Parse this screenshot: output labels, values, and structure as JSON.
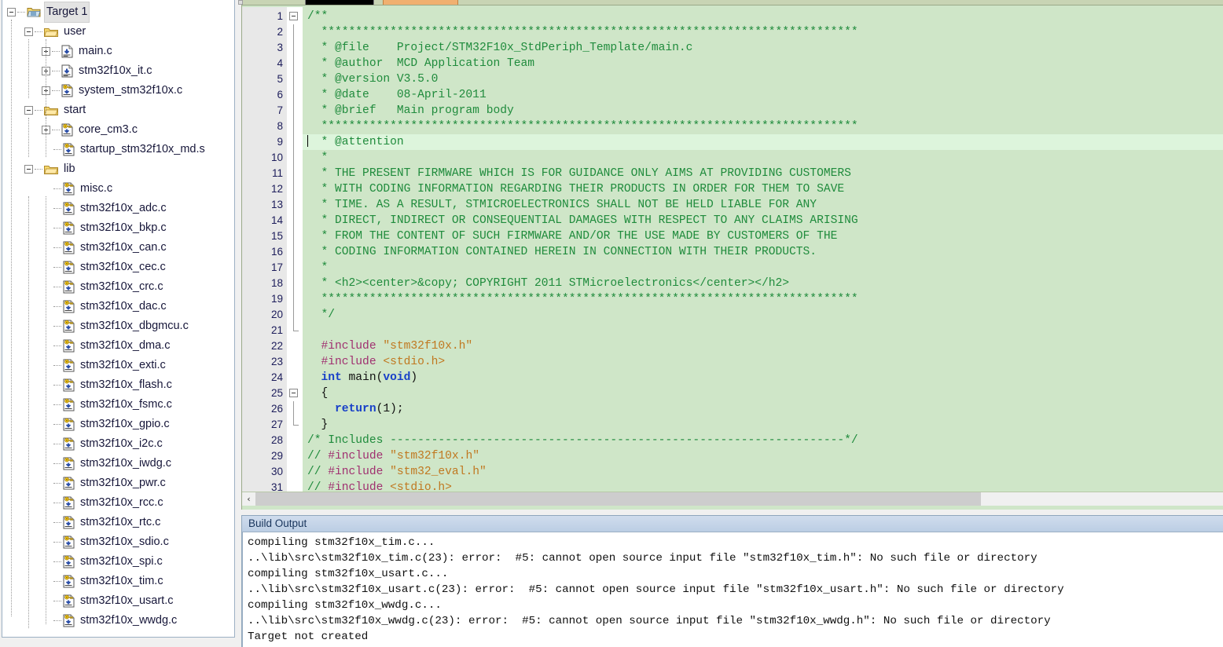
{
  "project": {
    "root": {
      "label": "Target 1",
      "icon": "project-target-icon",
      "selected": true,
      "expander": "minus"
    },
    "groups": [
      {
        "label": "user",
        "icon": "folder-icon",
        "expander": "minus",
        "files": [
          {
            "label": "main.c",
            "icon": "c-source-icon",
            "expander": "plus"
          },
          {
            "label": "stm32f10x_it.c",
            "icon": "c-source-icon",
            "expander": "plus"
          },
          {
            "label": "system_stm32f10x.c",
            "icon": "c-source-compiled-icon",
            "expander": "plus"
          }
        ]
      },
      {
        "label": "start",
        "icon": "folder-icon",
        "expander": "minus",
        "files": [
          {
            "label": "core_cm3.c",
            "icon": "c-source-compiled-icon",
            "expander": "plus"
          },
          {
            "label": "startup_stm32f10x_md.s",
            "icon": "c-source-compiled-icon",
            "expander": "none"
          }
        ]
      },
      {
        "label": "lib",
        "icon": "folder-icon",
        "expander": "minus",
        "files": [
          {
            "label": "misc.c",
            "icon": "c-source-compiled-icon",
            "expander": "none"
          },
          {
            "label": "stm32f10x_adc.c",
            "icon": "c-source-compiled-icon",
            "expander": "none"
          },
          {
            "label": "stm32f10x_bkp.c",
            "icon": "c-source-compiled-icon",
            "expander": "none"
          },
          {
            "label": "stm32f10x_can.c",
            "icon": "c-source-compiled-icon",
            "expander": "none"
          },
          {
            "label": "stm32f10x_cec.c",
            "icon": "c-source-compiled-icon",
            "expander": "none"
          },
          {
            "label": "stm32f10x_crc.c",
            "icon": "c-source-compiled-icon",
            "expander": "none"
          },
          {
            "label": "stm32f10x_dac.c",
            "icon": "c-source-compiled-icon",
            "expander": "none"
          },
          {
            "label": "stm32f10x_dbgmcu.c",
            "icon": "c-source-compiled-icon",
            "expander": "none"
          },
          {
            "label": "stm32f10x_dma.c",
            "icon": "c-source-compiled-icon",
            "expander": "none"
          },
          {
            "label": "stm32f10x_exti.c",
            "icon": "c-source-compiled-icon",
            "expander": "none"
          },
          {
            "label": "stm32f10x_flash.c",
            "icon": "c-source-compiled-icon",
            "expander": "none"
          },
          {
            "label": "stm32f10x_fsmc.c",
            "icon": "c-source-compiled-icon",
            "expander": "none"
          },
          {
            "label": "stm32f10x_gpio.c",
            "icon": "c-source-compiled-icon",
            "expander": "none"
          },
          {
            "label": "stm32f10x_i2c.c",
            "icon": "c-source-compiled-icon",
            "expander": "none"
          },
          {
            "label": "stm32f10x_iwdg.c",
            "icon": "c-source-compiled-icon",
            "expander": "none"
          },
          {
            "label": "stm32f10x_pwr.c",
            "icon": "c-source-compiled-icon",
            "expander": "none"
          },
          {
            "label": "stm32f10x_rcc.c",
            "icon": "c-source-compiled-icon",
            "expander": "none"
          },
          {
            "label": "stm32f10x_rtc.c",
            "icon": "c-source-compiled-icon",
            "expander": "none"
          },
          {
            "label": "stm32f10x_sdio.c",
            "icon": "c-source-compiled-icon",
            "expander": "none"
          },
          {
            "label": "stm32f10x_spi.c",
            "icon": "c-source-compiled-icon",
            "expander": "none"
          },
          {
            "label": "stm32f10x_tim.c",
            "icon": "c-source-compiled-icon",
            "expander": "none"
          },
          {
            "label": "stm32f10x_usart.c",
            "icon": "c-source-compiled-icon",
            "expander": "none"
          },
          {
            "label": "stm32f10x_wwdg.c",
            "icon": "c-source-compiled-icon",
            "expander": "none"
          }
        ]
      }
    ]
  },
  "editor": {
    "current_line": 9,
    "first_line": 1,
    "last_line": 31,
    "colors": {
      "background": "#cfe6c8",
      "current_line": "#ddf5dc",
      "comment": "#1f8b3c",
      "preprocessor": "#a03070",
      "string": "#c07820",
      "keyword": "#1840c8",
      "gutter": "#e8e8e8",
      "line_number": "#1c1c5a"
    },
    "fold_markers": [
      {
        "line": 1,
        "type": "minus"
      },
      {
        "line": 21,
        "type": "end"
      },
      {
        "line": 25,
        "type": "minus"
      },
      {
        "line": 27,
        "type": "end"
      }
    ],
    "lines": [
      {
        "n": 1,
        "tokens": [
          {
            "t": "/**",
            "c": "cm"
          }
        ]
      },
      {
        "n": 2,
        "tokens": [
          {
            "t": "  ******************************************************************************",
            "c": "cm"
          }
        ]
      },
      {
        "n": 3,
        "tokens": [
          {
            "t": "  * @file    Project/STM32F10x_StdPeriph_Template/main.c",
            "c": "cm"
          }
        ]
      },
      {
        "n": 4,
        "tokens": [
          {
            "t": "  * @author  MCD Application Team",
            "c": "cm"
          }
        ]
      },
      {
        "n": 5,
        "tokens": [
          {
            "t": "  * @version V3.5.0",
            "c": "cm"
          }
        ]
      },
      {
        "n": 6,
        "tokens": [
          {
            "t": "  * @date    08-April-2011",
            "c": "cm"
          }
        ]
      },
      {
        "n": 7,
        "tokens": [
          {
            "t": "  * @brief   Main program body",
            "c": "cm"
          }
        ]
      },
      {
        "n": 8,
        "tokens": [
          {
            "t": "  ******************************************************************************",
            "c": "cm"
          }
        ]
      },
      {
        "n": 9,
        "tokens": [
          {
            "t": "  * @attention",
            "c": "cm"
          }
        ],
        "caret_col": 2
      },
      {
        "n": 10,
        "tokens": [
          {
            "t": "  *",
            "c": "cm"
          }
        ]
      },
      {
        "n": 11,
        "tokens": [
          {
            "t": "  * THE PRESENT FIRMWARE WHICH IS FOR GUIDANCE ONLY AIMS AT PROVIDING CUSTOMERS",
            "c": "cm"
          }
        ]
      },
      {
        "n": 12,
        "tokens": [
          {
            "t": "  * WITH CODING INFORMATION REGARDING THEIR PRODUCTS IN ORDER FOR THEM TO SAVE",
            "c": "cm"
          }
        ]
      },
      {
        "n": 13,
        "tokens": [
          {
            "t": "  * TIME. AS A RESULT, STMICROELECTRONICS SHALL NOT BE HELD LIABLE FOR ANY",
            "c": "cm"
          }
        ]
      },
      {
        "n": 14,
        "tokens": [
          {
            "t": "  * DIRECT, INDIRECT OR CONSEQUENTIAL DAMAGES WITH RESPECT TO ANY CLAIMS ARISING",
            "c": "cm"
          }
        ]
      },
      {
        "n": 15,
        "tokens": [
          {
            "t": "  * FROM THE CONTENT OF SUCH FIRMWARE AND/OR THE USE MADE BY CUSTOMERS OF THE",
            "c": "cm"
          }
        ]
      },
      {
        "n": 16,
        "tokens": [
          {
            "t": "  * CODING INFORMATION CONTAINED HEREIN IN CONNECTION WITH THEIR PRODUCTS.",
            "c": "cm"
          }
        ]
      },
      {
        "n": 17,
        "tokens": [
          {
            "t": "  *",
            "c": "cm"
          }
        ]
      },
      {
        "n": 18,
        "tokens": [
          {
            "t": "  * <h2><center>&copy; COPYRIGHT 2011 STMicroelectronics</center></h2>",
            "c": "cm"
          }
        ]
      },
      {
        "n": 19,
        "tokens": [
          {
            "t": "  ******************************************************************************",
            "c": "cm"
          }
        ]
      },
      {
        "n": 20,
        "tokens": [
          {
            "t": "  */",
            "c": "cm"
          }
        ]
      },
      {
        "n": 21,
        "tokens": [
          {
            "t": "",
            "c": "pl"
          }
        ]
      },
      {
        "n": 22,
        "tokens": [
          {
            "t": "  #include ",
            "c": "pp"
          },
          {
            "t": "\"stm32f10x.h\"",
            "c": "str"
          }
        ]
      },
      {
        "n": 23,
        "tokens": [
          {
            "t": "  #include ",
            "c": "pp"
          },
          {
            "t": "<stdio.h>",
            "c": "str"
          }
        ]
      },
      {
        "n": 24,
        "tokens": [
          {
            "t": "  ",
            "c": "pl"
          },
          {
            "t": "int",
            "c": "kw"
          },
          {
            "t": " main",
            "c": "id"
          },
          {
            "t": "(",
            "c": "pl"
          },
          {
            "t": "void",
            "c": "kw"
          },
          {
            "t": ")",
            "c": "pl"
          }
        ]
      },
      {
        "n": 25,
        "tokens": [
          {
            "t": "  {",
            "c": "pl"
          }
        ]
      },
      {
        "n": 26,
        "tokens": [
          {
            "t": "    ",
            "c": "pl"
          },
          {
            "t": "return",
            "c": "kw"
          },
          {
            "t": "(1);",
            "c": "pl"
          }
        ]
      },
      {
        "n": 27,
        "tokens": [
          {
            "t": "  }",
            "c": "pl"
          }
        ]
      },
      {
        "n": 28,
        "tokens": [
          {
            "t": "/* Includes ------------------------------------------------------------------*/",
            "c": "cm"
          }
        ]
      },
      {
        "n": 29,
        "tokens": [
          {
            "t": "// ",
            "c": "cm"
          },
          {
            "t": "#include ",
            "c": "pp"
          },
          {
            "t": "\"stm32f10x.h\"",
            "c": "str"
          }
        ]
      },
      {
        "n": 30,
        "tokens": [
          {
            "t": "// ",
            "c": "cm"
          },
          {
            "t": "#include ",
            "c": "pp"
          },
          {
            "t": "\"stm32_eval.h\"",
            "c": "str"
          }
        ]
      },
      {
        "n": 31,
        "tokens": [
          {
            "t": "// ",
            "c": "cm"
          },
          {
            "t": "#include ",
            "c": "pp"
          },
          {
            "t": "<stdio.h>",
            "c": "str"
          }
        ]
      }
    ],
    "hscrollbar": {
      "left_arrow": "‹",
      "thumb_percent": 75
    }
  },
  "build_output": {
    "title": "Build Output",
    "lines": [
      "compiling stm32f10x_tim.c...",
      "..\\lib\\src\\stm32f10x_tim.c(23): error:  #5: cannot open source input file \"stm32f10x_tim.h\": No such file or directory",
      "compiling stm32f10x_usart.c...",
      "..\\lib\\src\\stm32f10x_usart.c(23): error:  #5: cannot open source input file \"stm32f10x_usart.h\": No such file or directory",
      "compiling stm32f10x_wwdg.c...",
      "..\\lib\\src\\stm32f10x_wwdg.c(23): error:  #5: cannot open source input file \"stm32f10x_wwdg.h\": No such file or directory",
      "Target not created"
    ]
  }
}
